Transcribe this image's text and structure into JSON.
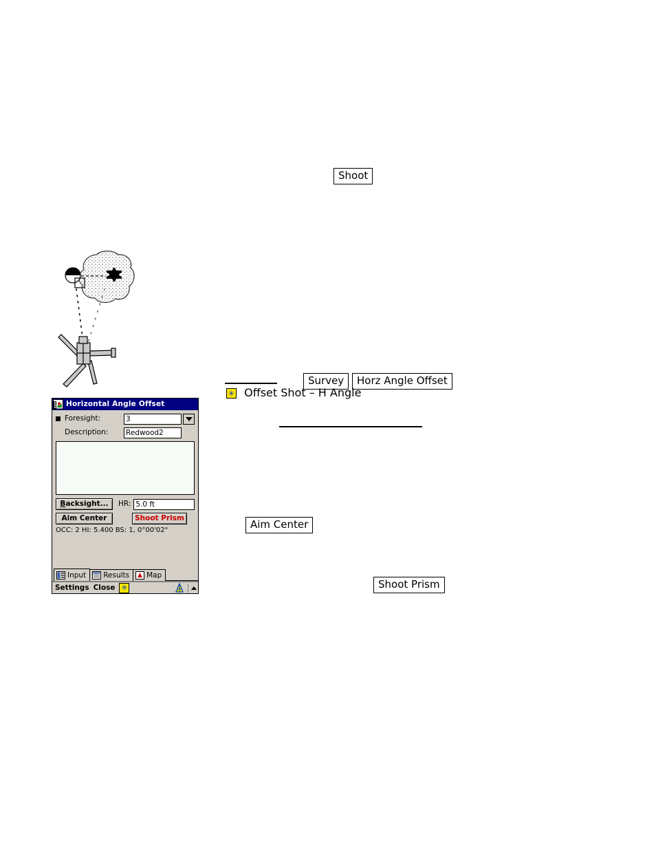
{
  "document": {
    "shoot_button_label": "Shoot",
    "survey_box_label": "Survey",
    "horz_angle_offset_box_label": "Horz Angle Offset",
    "offset_shot_menu_label": "Offset Shot – H Angle",
    "aim_center_box_label": "Aim Center",
    "shoot_prism_box_label": "Shoot Prism"
  },
  "illustration": {
    "name": "tree-canopy-prism-total-station-diagram",
    "tree_label": "tree-canopy",
    "prism_label": "prism-target",
    "center_label": "tree-center-cross",
    "instrument_label": "total-station-tripod"
  },
  "pda": {
    "title": "Horizontal Angle Offset",
    "title_icon": "app-icon",
    "fields": {
      "foresight_label": "Foresight:",
      "foresight_value": "3",
      "description_label": "Description:",
      "description_value": "Redwood2"
    },
    "buttons": {
      "backsight": "Backsight...",
      "aim_center": "Aim Center",
      "shoot_prism": "Shoot Prism"
    },
    "hr": {
      "label": "HR:",
      "value": "5.0 ft"
    },
    "status": "OCC: 2  HI: 5.400  BS: 1, 0°00'02\"",
    "tabs": [
      {
        "label": "Input",
        "icon": "input-form-icon",
        "active": true
      },
      {
        "label": "Results",
        "icon": "results-list-icon",
        "active": false
      },
      {
        "label": "Map",
        "icon": "map-icon",
        "active": false
      }
    ],
    "command_bar": {
      "settings": "Settings",
      "close": "Close",
      "star_icon": "star-badge-icon",
      "tripod_icon": "tripod-icon",
      "caret_icon": "up-caret-icon"
    },
    "colors": {
      "titlebar": "#000080",
      "face": "#d4d0c8",
      "shoot_prism_text": "#cc0000",
      "star_badge": "#ffe600"
    }
  }
}
